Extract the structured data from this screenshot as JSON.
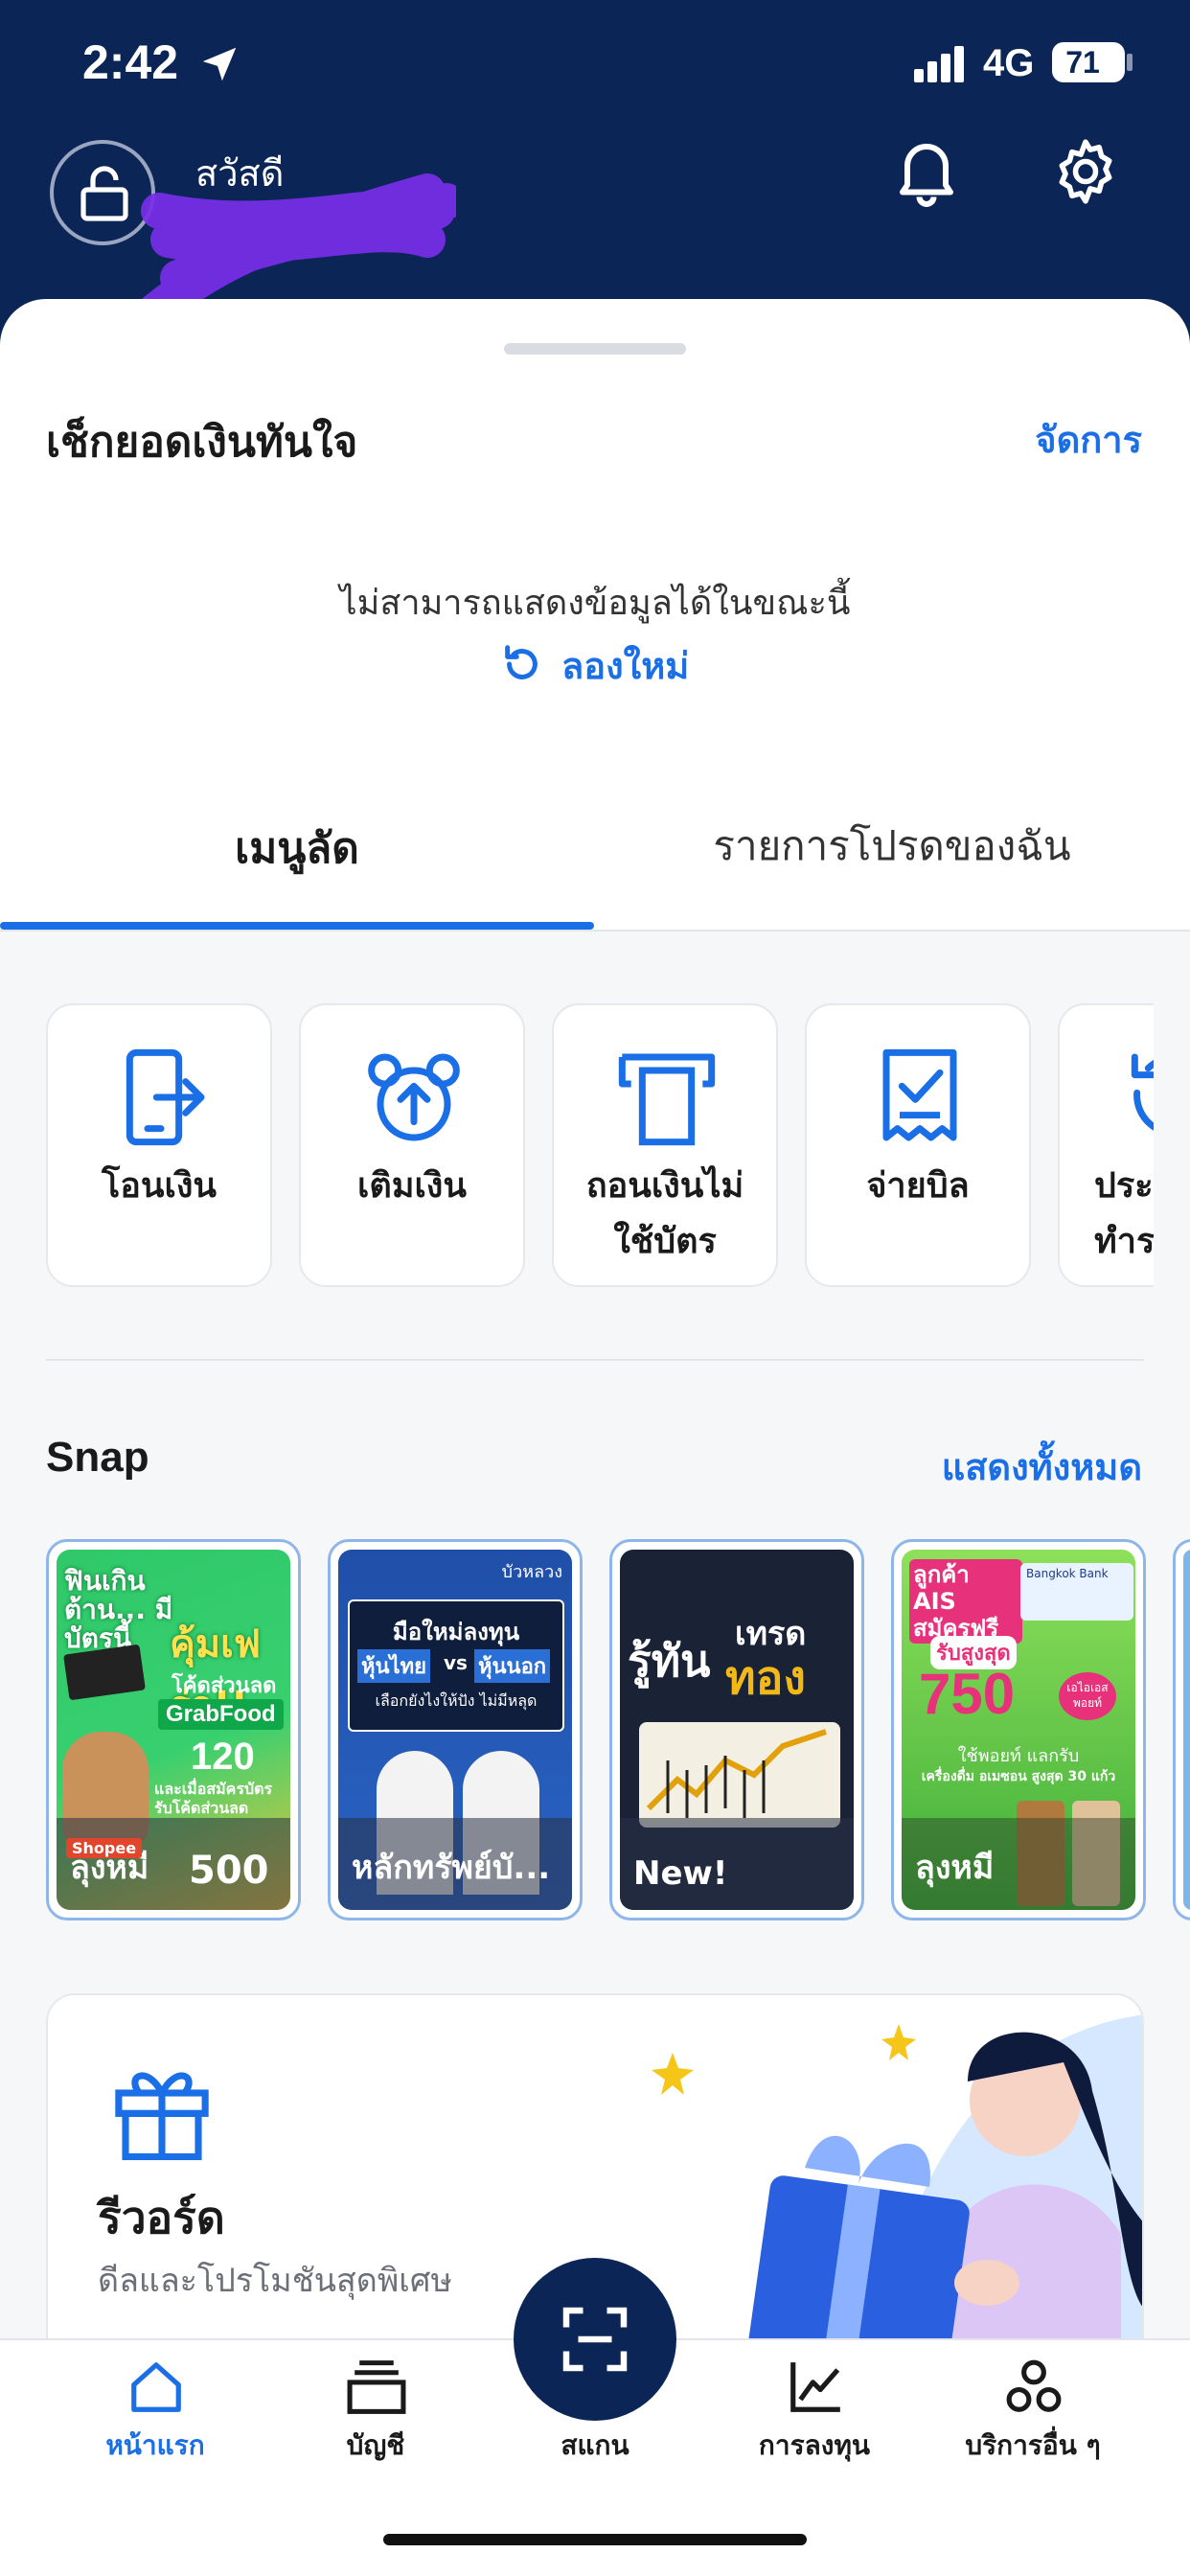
{
  "status_bar": {
    "time": "2:42",
    "network": "4G",
    "battery": "71"
  },
  "header": {
    "greeting": "สวัสดี"
  },
  "balance_section": {
    "title": "เช็กยอดเงินทันใจ",
    "manage_label": "จัดการ",
    "error_message": "ไม่สามารถแสดงข้อมูลได้ในขณะนี้",
    "retry_label": "ลองใหม่"
  },
  "tabs": [
    {
      "label": "เมนูลัด",
      "active": true
    },
    {
      "label": "รายการโปรดของฉัน",
      "active": false
    }
  ],
  "quick_menu": [
    {
      "label": "โอนเงิน",
      "icon": "transfer-icon"
    },
    {
      "label": "เติมเงิน",
      "icon": "top-up-icon"
    },
    {
      "label": "ถอนเงินไม่\nใช้บัตร",
      "icon": "cardless-withdraw-icon"
    },
    {
      "label": "จ่ายบิล",
      "icon": "bill-payment-icon"
    },
    {
      "label": "ประวัติ\nทำราย",
      "icon": "history-icon"
    }
  ],
  "snap": {
    "title": "Snap",
    "show_all_label": "แสดงทั้งหมด",
    "cards": [
      {
        "caption": "ลุงหมี",
        "image_texts": [
          "ฟินเกินต้าน... มีบัตรนี้",
          "คุ้มเฟร่อ!!",
          "โค้ดส่วนลด",
          "GrabFood",
          "120",
          "และเมื่อสมัครบัตร รับโค้ดส่วนลด",
          "Shopee",
          "500"
        ]
      },
      {
        "caption": "หลักทรัพย์บั...",
        "image_texts": [
          "มือใหม่ลงทุน",
          "หุ้นไทย",
          "vs",
          "หุ้นนอก",
          "เลือกยังไงให้ปัง ไม่มีหลุด",
          "บัวหลวง"
        ]
      },
      {
        "caption": "New!",
        "image_texts": [
          "รู้ทัน",
          "เทรด",
          "ทอง"
        ]
      },
      {
        "caption": "ลุงหมี",
        "image_texts": [
          "ลูกค้า AIS สมัครฟรี",
          "Bangkok Bank",
          "รับสูงสุด",
          "750",
          "เอไอเอส พอยท์",
          "ใช้พอยท์ แลกรับ",
          "เครื่องดื่ม อเมซอน สูงสุด 30 แก้ว"
        ]
      }
    ]
  },
  "rewards": {
    "title": "รีวอร์ด",
    "subtitle": "ดีลและโปรโมชันสุดพิเศษ"
  },
  "bottom_nav": [
    {
      "label": "หน้าแรก",
      "icon": "home-icon",
      "active": true
    },
    {
      "label": "บัญชี",
      "icon": "accounts-icon",
      "active": false
    },
    {
      "label": "สแกน",
      "icon": "scan-icon",
      "active": false
    },
    {
      "label": "การลงทุน",
      "icon": "investment-chart-icon",
      "active": false
    },
    {
      "label": "บริการอื่น ๆ",
      "icon": "more-services-icon",
      "active": false
    }
  ],
  "colors": {
    "header_bg": "#0b2556",
    "accent": "#1a6ee6",
    "scan_button": "#0b2556"
  }
}
